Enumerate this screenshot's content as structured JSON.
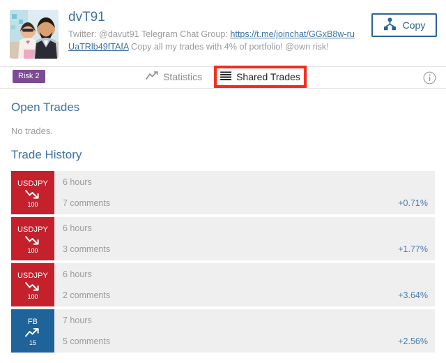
{
  "header": {
    "avatar_alt": "profile-photo",
    "profile_name": "dvT91",
    "description_prefix": "Twitter: @davut91 Telegram Chat Group: ",
    "description_link": "https://t.me/joinchat/GGxB8w-ruUaTRlb49fTAfA",
    "description_suffix": " Copy all my trades with 4% of portfolio! @own risk!",
    "copy_label": "Copy",
    "copy_icon": "share-network-icon"
  },
  "tabbar": {
    "risk_badge": "Risk 2",
    "tabs": [
      {
        "label": "Statistics",
        "icon": "line-chart-icon",
        "active": false
      },
      {
        "label": "Shared Trades",
        "icon": "list-lines-icon",
        "active": true
      }
    ],
    "info_icon": "info-circle-icon"
  },
  "open_trades": {
    "title": "Open Trades",
    "empty_text": "No trades."
  },
  "trade_history": {
    "title": "Trade History",
    "rows": [
      {
        "symbol": "USDJPY",
        "quantity": "100",
        "direction": "down",
        "icon": "arrow-down-trend-icon",
        "time": "6 hours",
        "comments": "7 comments",
        "percent": "+0.71%"
      },
      {
        "symbol": "USDJPY",
        "quantity": "100",
        "direction": "down",
        "icon": "arrow-down-trend-icon",
        "time": "6 hours",
        "comments": "3 comments",
        "percent": "+1.77%"
      },
      {
        "symbol": "USDJPY",
        "quantity": "100",
        "direction": "down",
        "icon": "arrow-down-trend-icon",
        "time": "6 hours",
        "comments": "2 comments",
        "percent": "+3.64%"
      },
      {
        "symbol": "FB",
        "quantity": "15",
        "direction": "up",
        "icon": "arrow-up-trend-icon",
        "time": "7 hours",
        "comments": "5 comments",
        "percent": "+2.56%"
      }
    ]
  },
  "colors": {
    "accent_blue": "#3d72a4",
    "button_blue": "#2a6496",
    "risk_purple": "#7c4b96",
    "sell_red": "#c4212d",
    "buy_blue": "#1e6399",
    "row_bg": "#efefef",
    "highlight_red": "#fa2a1a",
    "muted_text": "#9b9b9b"
  }
}
